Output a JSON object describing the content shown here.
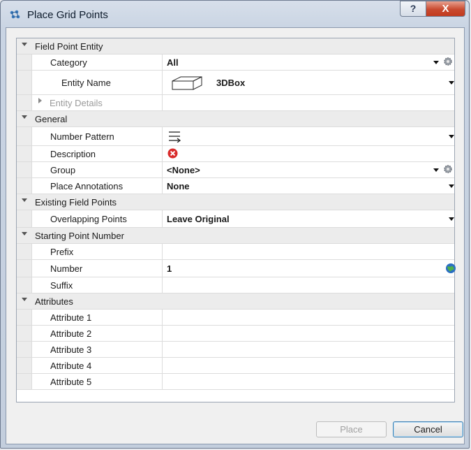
{
  "window": {
    "title": "Place Grid Points",
    "help_label": "?",
    "close_label": "X"
  },
  "sections": {
    "field_point_entity": "Field Point Entity",
    "general": "General",
    "existing_field_points": "Existing Field Points",
    "starting_point_number": "Starting Point Number",
    "attributes": "Attributes"
  },
  "props": {
    "category": {
      "label": "Category",
      "value": "All"
    },
    "entity_name": {
      "label": "Entity Name",
      "value": "3DBox"
    },
    "entity_details": {
      "label": "Entity Details"
    },
    "number_pattern": {
      "label": "Number Pattern"
    },
    "description": {
      "label": "Description"
    },
    "group": {
      "label": "Group",
      "value": "<None>"
    },
    "place_annotations": {
      "label": "Place Annotations",
      "value": "None"
    },
    "overlapping_points": {
      "label": "Overlapping Points",
      "value": "Leave Original"
    },
    "prefix": {
      "label": "Prefix",
      "value": ""
    },
    "number": {
      "label": "Number",
      "value": "1"
    },
    "suffix": {
      "label": "Suffix",
      "value": ""
    },
    "attribute_1": {
      "label": "Attribute 1",
      "value": ""
    },
    "attribute_2": {
      "label": "Attribute 2",
      "value": ""
    },
    "attribute_3": {
      "label": "Attribute 3",
      "value": ""
    },
    "attribute_4": {
      "label": "Attribute 4",
      "value": ""
    },
    "attribute_5": {
      "label": "Attribute 5",
      "value": ""
    }
  },
  "buttons": {
    "place": "Place",
    "cancel": "Cancel"
  },
  "icons": {
    "title": "grid-points-icon",
    "entity": "3d-box-icon",
    "pattern": "number-pattern-icon",
    "error": "error-icon",
    "gear": "gear-icon",
    "globe": "globe-icon"
  },
  "colors": {
    "error": "#d92b2b",
    "accent": "#3c7fb1",
    "close": "#c94a2f"
  }
}
